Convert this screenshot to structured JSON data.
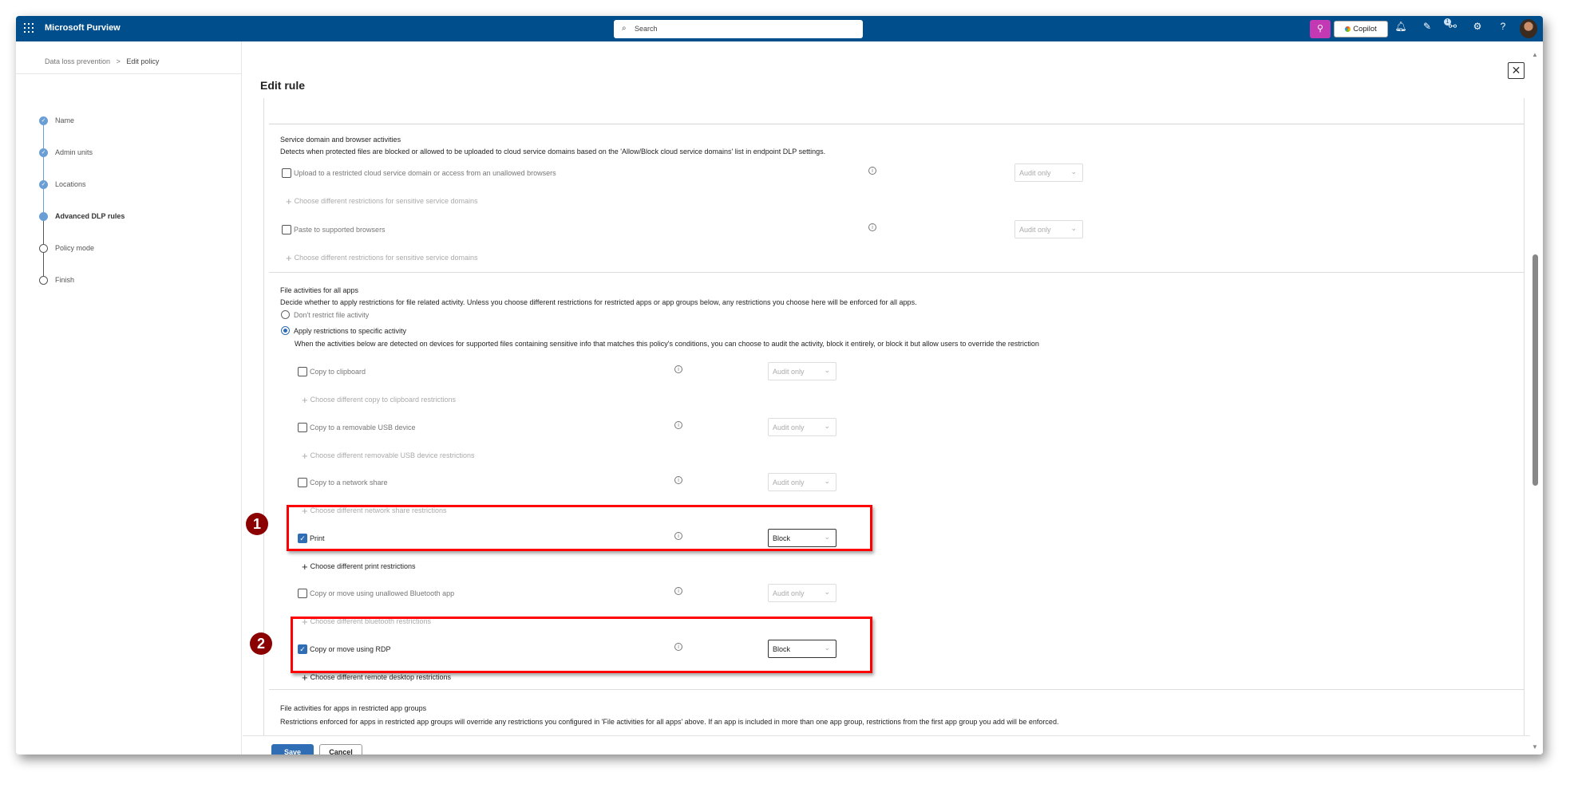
{
  "header": {
    "app_name": "Microsoft Purview",
    "search_placeholder": "Search",
    "copilot_label": "Copilot",
    "notification_badge": "1",
    "help_label": "?"
  },
  "breadcrumb": {
    "parent": "Data loss prevention",
    "separator": ">",
    "current": "Edit policy"
  },
  "steps": [
    {
      "label": "Name",
      "state": "done"
    },
    {
      "label": "Admin units",
      "state": "done"
    },
    {
      "label": "Locations",
      "state": "done"
    },
    {
      "label": "Advanced DLP rules",
      "state": "current"
    },
    {
      "label": "Policy mode",
      "state": "todo"
    },
    {
      "label": "Finish",
      "state": "todo"
    }
  ],
  "panel": {
    "title": "Edit rule",
    "close_label": "✕",
    "service_section": {
      "title": "Service domain and browser activities",
      "description": "Detects when protected files are blocked or allowed to be uploaded to cloud service domains based on the 'Allow/Block cloud service domains' list in endpoint DLP settings.",
      "rows": [
        {
          "label": "Upload to a restricted cloud service domain or access from an unallowed browsers",
          "checked": false,
          "action": "Audit only",
          "choose": "Choose different restrictions for sensitive service domains"
        },
        {
          "label": "Paste to supported browsers",
          "checked": false,
          "action": "Audit only",
          "choose": "Choose different restrictions for sensitive service domains"
        }
      ]
    },
    "file_section": {
      "title": "File activities for all apps",
      "description": "Decide whether to apply restrictions for file related activity. Unless you choose different restrictions for restricted apps or app groups below, any restrictions you choose here will be enforced for all apps.",
      "radio_none": "Don't restrict file activity",
      "radio_apply": "Apply restrictions to specific activity",
      "apply_description": "When the activities below are detected on devices for supported files containing sensitive info that matches this policy's conditions, you can choose to audit the activity, block it entirely, or block it but allow users to override the restriction",
      "rows": [
        {
          "label": "Copy to clipboard",
          "checked": false,
          "action": "Audit only",
          "choose": "Choose different copy to clipboard restrictions"
        },
        {
          "label": "Copy to a removable USB device",
          "checked": false,
          "action": "Audit only",
          "choose": "Choose different removable USB device restrictions"
        },
        {
          "label": "Copy to a network share",
          "checked": false,
          "action": "Audit only",
          "choose": "Choose different network share restrictions"
        },
        {
          "label": "Print",
          "checked": true,
          "action": "Block",
          "choose": "Choose different print restrictions"
        },
        {
          "label": "Copy or move using unallowed Bluetooth app",
          "checked": false,
          "action": "Audit only",
          "choose": "Choose different bluetooth restrictions"
        },
        {
          "label": "Copy or move using RDP",
          "checked": true,
          "action": "Block",
          "choose": "Choose different remote desktop restrictions"
        }
      ]
    },
    "restricted_section": {
      "title": "File activities for apps in restricted app groups",
      "description": "Restrictions enforced for apps in restricted app groups will override any restrictions you configured in 'File activities for all apps' above. If an app is included in more than one app group, restrictions from the first app group you add will be enforced."
    }
  },
  "footer": {
    "save_label": "Save",
    "cancel_label": "Cancel"
  },
  "annotations": {
    "first": "1",
    "second": "2"
  },
  "colors": {
    "header": "#004e8c",
    "accent": "#2f6db5",
    "highlight": "#ff0000",
    "annotation": "#8b0000"
  }
}
